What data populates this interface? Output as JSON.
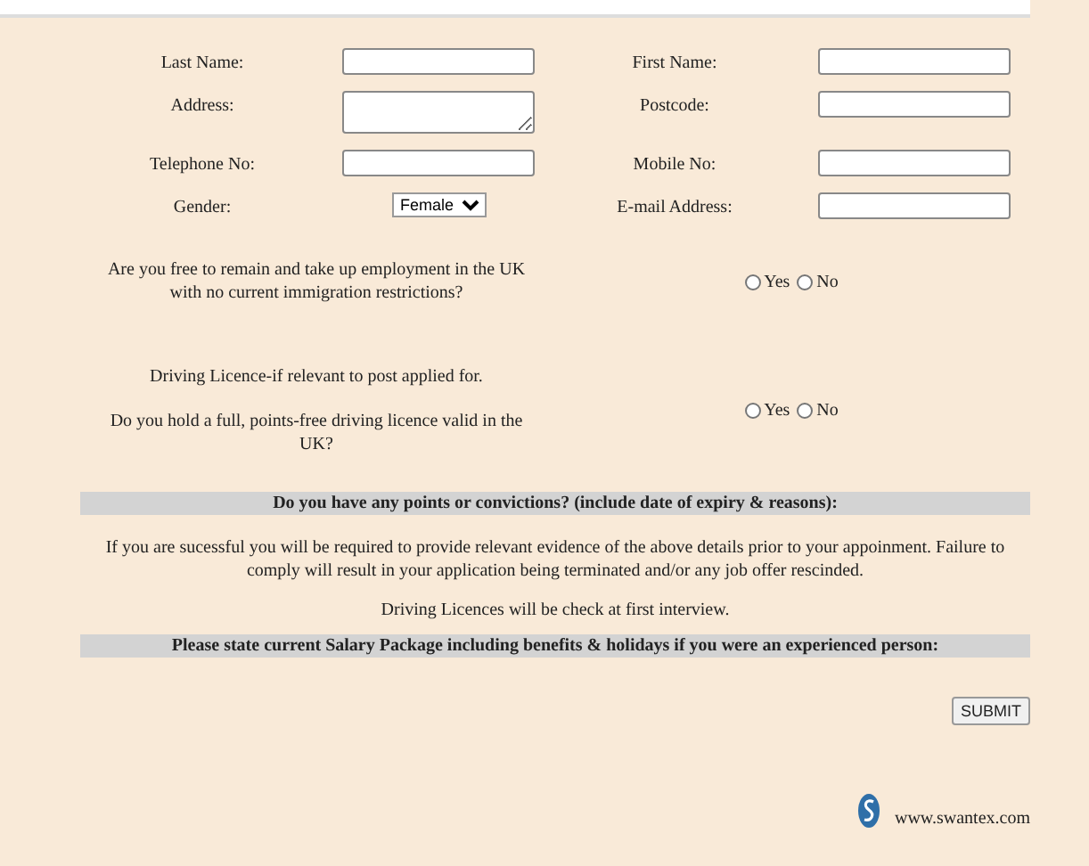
{
  "fields": [
    {
      "label": "Last Name:",
      "kind": "text"
    },
    {
      "label": "First Name:",
      "kind": "text"
    },
    {
      "label": "Address:",
      "kind": "textarea"
    },
    {
      "label": "Postcode:",
      "kind": "text"
    },
    {
      "label": "Telephone No:",
      "kind": "text"
    },
    {
      "label": "Mobile No:",
      "kind": "text"
    },
    {
      "label": "Gender:",
      "kind": "select",
      "value": "Female"
    },
    {
      "label": "E-mail Address:",
      "kind": "text"
    }
  ],
  "questions": [
    {
      "texts": [
        "Are you free to remain and take up employment in the UK with no current immigration restrictions?"
      ],
      "options": [
        {
          "label": "Yes",
          "selected": false
        },
        {
          "label": "No",
          "selected": false
        }
      ]
    },
    {
      "texts": [
        "Driving Licence-if relevant to post applied for.",
        "Do you hold a full, points-free driving licence valid in the UK?"
      ],
      "options": [
        {
          "label": "Yes",
          "selected": false
        },
        {
          "label": "No",
          "selected": false
        }
      ]
    }
  ],
  "convictions_heading": "Do you have any points or convictions? (include date of expiry & reasons):",
  "notice": "If you are sucessful you will be required to provide relevant evidence of the above details prior to your appoinment. Failure to comply will result in your application being terminated and/or any job offer rescinded.",
  "licence_note": "Driving Licences will be check at first interview.",
  "salary_heading": "Please state current Salary Package including benefits & holidays if you were an experienced person:",
  "submit": "SUBMIT",
  "footer": {
    "website": "www.swantex.com"
  }
}
